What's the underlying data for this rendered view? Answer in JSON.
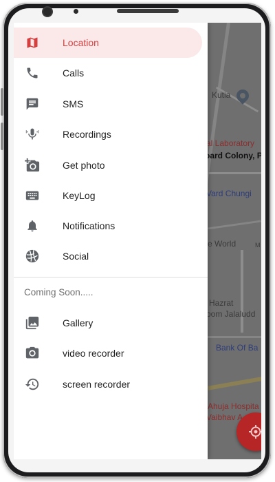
{
  "colors": {
    "accent": "#d43f3f",
    "selected_bg": "#fbe9ea",
    "icon_gray": "#5f6368",
    "fab": "#b62626"
  },
  "drawer": {
    "items": [
      {
        "label": "Location",
        "icon": "map-icon",
        "selected": true
      },
      {
        "label": "Calls",
        "icon": "phone-icon"
      },
      {
        "label": "SMS",
        "icon": "message-icon"
      },
      {
        "label": "Recordings",
        "icon": "microphone-icon"
      },
      {
        "label": "Get photo",
        "icon": "camera-icon"
      },
      {
        "label": "KeyLog",
        "icon": "keyboard-icon"
      },
      {
        "label": "Notifications",
        "icon": "bell-icon"
      },
      {
        "label": "Social",
        "icon": "globe-icon"
      }
    ],
    "coming_soon_header": "Coming Soon.....",
    "coming_soon_items": [
      {
        "label": "Gallery",
        "icon": "image-icon"
      },
      {
        "label": "video recorder",
        "icon": "photo-camera-icon"
      },
      {
        "label": "screen recorder",
        "icon": "history-icon"
      }
    ]
  },
  "map": {
    "labels": [
      {
        "text": "Kutia",
        "color": "#3a3a3a"
      },
      {
        "text": "al Laboratory",
        "color": "#8b2d2d"
      },
      {
        "text": "oard Colony, P",
        "color": "#111111"
      },
      {
        "text": "Vard Chungi",
        "color": "#2d3d7a"
      },
      {
        "text": "e World",
        "color": "#3a3a3a"
      },
      {
        "text": "M",
        "color": "#3a3a3a"
      },
      {
        "text": "Hazrat",
        "color": "#3a3a3a"
      },
      {
        "text": "oom Jalaludd",
        "color": "#3a3a3a"
      },
      {
        "text": "Bank Of Ba",
        "color": "#2d3d7a"
      },
      {
        "text": "Ahuja Hospita",
        "color": "#8b2d2d"
      },
      {
        "text": "Vaibhav A",
        "color": "#8b2d2d"
      }
    ]
  }
}
